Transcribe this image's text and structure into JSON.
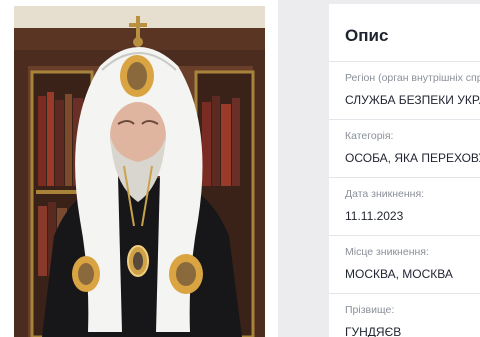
{
  "description_panel": {
    "title": "Опис",
    "fields": [
      {
        "label": "Регіон (орган внутрішніх спра",
        "value": "СЛУЖБА БЕЗПЕКИ УКРАЇ"
      },
      {
        "label": "Категорія:",
        "value": "ОСОБА, ЯКА ПЕРЕХОВУЄТ"
      },
      {
        "label": "Дата зникнення:",
        "value": "11.11.2023"
      },
      {
        "label": "Місце зникнення:",
        "value": "МОСКВА, МОСКВА"
      },
      {
        "label": "Прізвище:",
        "value": "ГУНДЯЄВ"
      }
    ]
  },
  "colors": {
    "page_background": "#ececef",
    "card_background": "#ffffff",
    "text_primary": "#1f2430",
    "text_muted": "#8a8f99",
    "divider": "#e4e5ea"
  }
}
